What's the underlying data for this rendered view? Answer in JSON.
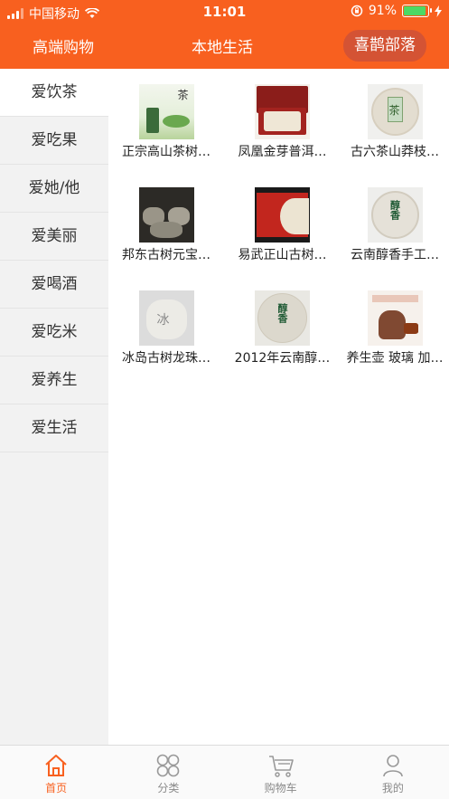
{
  "status": {
    "carrier": "中国移动",
    "time": "11:01",
    "battery": "91%",
    "battery_level": 0.91
  },
  "nav": {
    "left": "高端购物",
    "center": "本地生活",
    "right": "喜鹊部落"
  },
  "sidebar": {
    "items": [
      {
        "label": "爱饮茶"
      },
      {
        "label": "爱吃果"
      },
      {
        "label": "爱她/他"
      },
      {
        "label": "爱美丽"
      },
      {
        "label": "爱喝酒"
      },
      {
        "label": "爱吃米"
      },
      {
        "label": "爱养生"
      },
      {
        "label": "爱生活"
      }
    ]
  },
  "products": [
    {
      "name": "正宗高山茶树…"
    },
    {
      "name": "凤凰金芽普洱…"
    },
    {
      "name": "古六茶山莽枝…"
    },
    {
      "name": "邦东古树元宝…"
    },
    {
      "name": "易武正山古树…"
    },
    {
      "name": "云南醇香手工…"
    },
    {
      "name": "冰岛古树龙珠…"
    },
    {
      "name": "2012年云南醇…"
    },
    {
      "name": "养生壶 玻璃 加…"
    }
  ],
  "thumb_text": {
    "p0": "茶",
    "p2": "茶",
    "p5": "醇香",
    "p6": "冰",
    "p7": "醇香"
  },
  "tabbar": {
    "home": "首页",
    "category": "分类",
    "cart": "购物车",
    "mine": "我的"
  },
  "colors": {
    "accent": "#f8601f",
    "pill": "#d45334"
  }
}
